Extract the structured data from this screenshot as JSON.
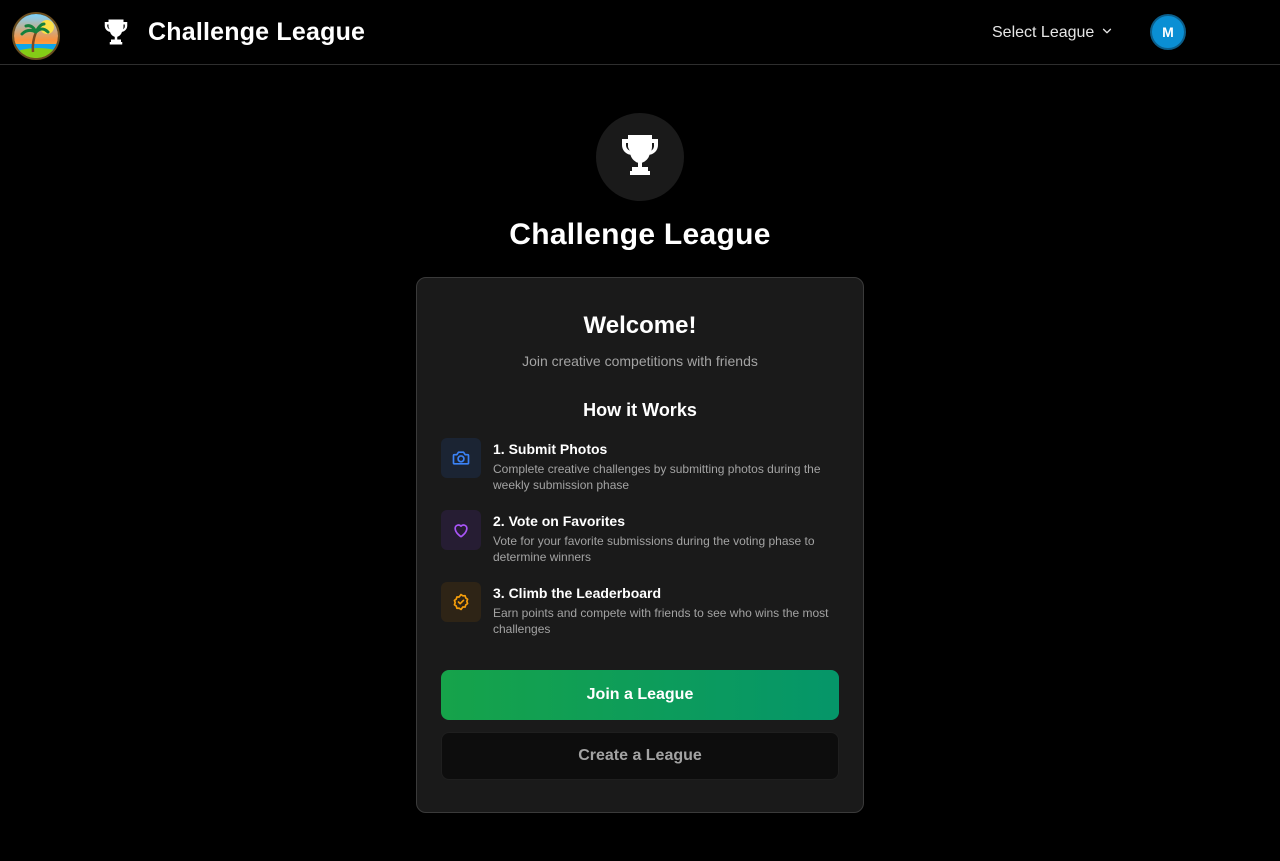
{
  "header": {
    "logo_icon": "beach-sunset-logo",
    "trophy_icon": "trophy-icon",
    "app_title": "Challenge League",
    "league_select": {
      "label": "Select League",
      "icon": "chevron-down-icon"
    },
    "avatar_initial": "M",
    "avatar_color": "#0a8fd4"
  },
  "hero": {
    "icon": "trophy-icon",
    "title": "Challenge League"
  },
  "card": {
    "welcome": "Welcome!",
    "subtitle": "Join creative competitions with friends",
    "how_title": "How it Works",
    "steps": [
      {
        "icon": "camera-icon",
        "color": "#3b82f6",
        "title": "1. Submit Photos",
        "description": "Complete creative challenges by submitting photos during the weekly submission phase"
      },
      {
        "icon": "heart-icon",
        "color": "#a855f7",
        "title": "2. Vote on Favorites",
        "description": "Vote for your favorite submissions during the voting phase to determine winners"
      },
      {
        "icon": "badge-check-icon",
        "color": "#f59e0b",
        "title": "3. Climb the Leaderboard",
        "description": "Earn points and compete with friends to see who wins the most challenges"
      }
    ],
    "join_button": "Join a League",
    "create_button": "Create a League"
  },
  "colors": {
    "accent_green_start": "#16a34a",
    "accent_green_end": "#059669",
    "card_background": "#1a1a1a",
    "page_background": "#000000"
  }
}
